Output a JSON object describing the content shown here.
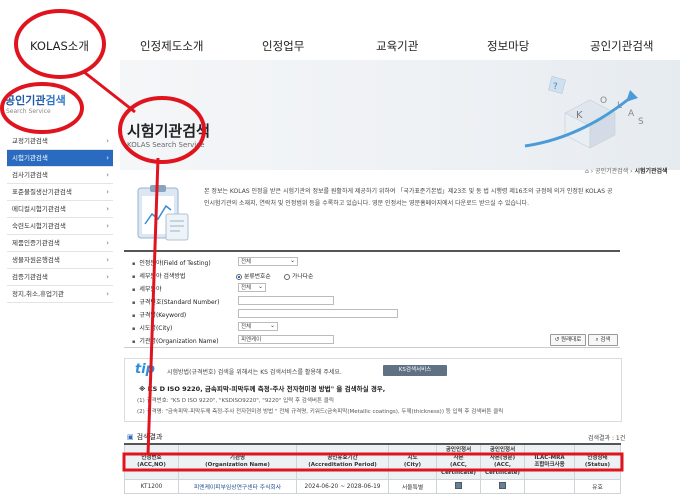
{
  "nav": {
    "items": [
      "KOLAS소개",
      "인정제도소개",
      "인정업무",
      "교육기관",
      "정보마당",
      "공인기관검색"
    ]
  },
  "sidebar": {
    "title_a": "공인기관",
    "title_b": "검색",
    "subtitle": "Search Service",
    "items": [
      {
        "label": "교정기관검색",
        "active": false
      },
      {
        "label": "시험기관검색",
        "active": true
      },
      {
        "label": "검사기관검색",
        "active": false
      },
      {
        "label": "표준물질생산기관검색",
        "active": false
      },
      {
        "label": "메디컬시험기관검색",
        "active": false
      },
      {
        "label": "숙련도시험기관검색",
        "active": false
      },
      {
        "label": "제품인증기관검색",
        "active": false
      },
      {
        "label": "생물자원은행검색",
        "active": false
      },
      {
        "label": "검증기관검색",
        "active": false
      },
      {
        "label": "정지,취소,휴업기관",
        "active": false
      }
    ]
  },
  "banner": {
    "title": "시험기관검색",
    "subtitle": "KOLAS Search Service"
  },
  "breadcrumb": {
    "home_icon": "home-icon",
    "path": "공인기관검색",
    "current": "시험기관검색"
  },
  "intro_text": "본 정보는 KOLAS 인정을 받은 시험기관의 정보를 원활하게 제공하기 위하여 「국가표준기본법」제23조 및 동 법 시행령 제16조의 규정에 의거 인정된 KOLAS 공인시험기관의 소재지, 연락처 및 인정범위 등을 수록하고 있습니다. 영문 인정서는 영문홈페이지에서 다운로드 받으실 수 있습니다.",
  "form": {
    "field_label": "인정분야(Field of Testing)",
    "field_value": "전체",
    "method_label": "세부분야 검색방법",
    "method_options": [
      "분류번호순",
      "가나다순"
    ],
    "method_selected": 0,
    "detail_label": "세부분야",
    "detail_value": "전체",
    "std_label": "규격번호(Standard Number)",
    "std_value": "",
    "kw_label": "규격명(Keyword)",
    "kw_value": "",
    "city_label": "시도명(City)",
    "city_value": "전체",
    "org_label": "기관명(Organization Name)",
    "org_value": "피엔케이",
    "reset_label": "원래대로",
    "search_label": "검색"
  },
  "tip": {
    "word": "tip",
    "line1": "시험방법(규격번호) 검색을 위해서는 KS 검색서비스를 활용해 주세요.",
    "ks_button": "KS검색서비스",
    "strong": "※ KS D ISO 9220, 금속피막-피막두께 측정-주사 전자현미경 방법\" 을 검색하실 경우,",
    "ex1": "(1) 규격번호: \"KS D ISO 9220\", \"KSDISO9220\", \"9220\" 입력 후 검색버튼 클릭",
    "ex2": "(2) 규격명: \"금속피막-피막두께 측정-주사 전자현미경 방법 \" 전체 규격명, 키워드(금속피막(Metallic coatings), 두께(thickness)) 등 입력 후 검색버튼 클릭"
  },
  "results": {
    "title": "검색결과",
    "count": "검색결과 : 1건",
    "headers": [
      [
        "인정번호",
        "(ACC,NO)"
      ],
      [
        "기관명",
        "(Organization Name)"
      ],
      [
        "공인유효기간",
        "(Accreditation Period)"
      ],
      [
        "시도",
        "(City)"
      ],
      [
        "공인인정서",
        "사본",
        "(ACC,",
        "Certificate)"
      ],
      [
        "공인인정서",
        "사본(영문)",
        "(ACC,",
        "Certificate)"
      ],
      [
        "ILAC-MRA",
        "조합마크사용"
      ],
      [
        "인정상태",
        "(Status)"
      ]
    ],
    "row": {
      "acc_no": "KT1200",
      "org": "피엔케이피부임상연구센타 주식회사",
      "period": "2024-06-20 ~ 2028-06-19",
      "city": "서울특별",
      "status": "유효"
    }
  }
}
